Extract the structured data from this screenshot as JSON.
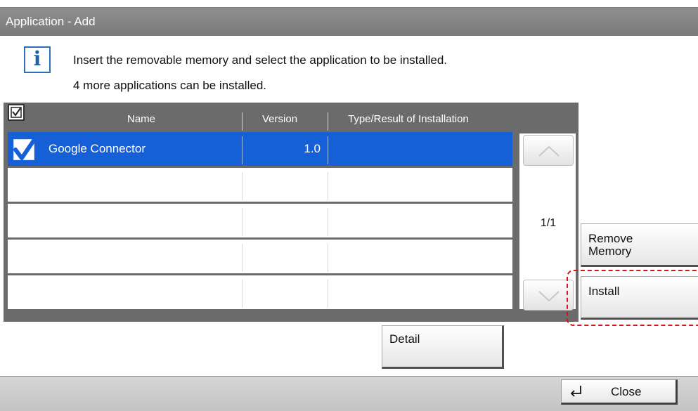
{
  "window": {
    "title": "Application - Add"
  },
  "messages": {
    "line1": "Insert the removable memory and select the application to be installed.",
    "line2": "4 more applications can be installed."
  },
  "table": {
    "columns": [
      "Name",
      "Version",
      "Type/Result of Installation"
    ],
    "rows": [
      {
        "checked": true,
        "name": "Google Connector",
        "version": "1.0",
        "type_result": ""
      },
      {
        "checked": false,
        "name": "",
        "version": "",
        "type_result": ""
      },
      {
        "checked": false,
        "name": "",
        "version": "",
        "type_result": ""
      },
      {
        "checked": false,
        "name": "",
        "version": "",
        "type_result": ""
      },
      {
        "checked": false,
        "name": "",
        "version": "",
        "type_result": ""
      }
    ],
    "page_indicator": "1/1"
  },
  "buttons": {
    "remove_memory": "Remove\nMemory",
    "install": "Install",
    "detail": "Detail",
    "close": "Close"
  },
  "icons": {
    "info": "info-icon",
    "header_check": "select-all-checkbox-icon",
    "row_check": "checkbox-checked-icon",
    "scroll_up": "chevron-up-icon",
    "scroll_down": "chevron-down-icon",
    "close": "return-arrow-icon"
  },
  "colors": {
    "title_bar": "#7f7f7f",
    "selected_row": "#1560d6",
    "highlight_dash": "#d8141a"
  }
}
